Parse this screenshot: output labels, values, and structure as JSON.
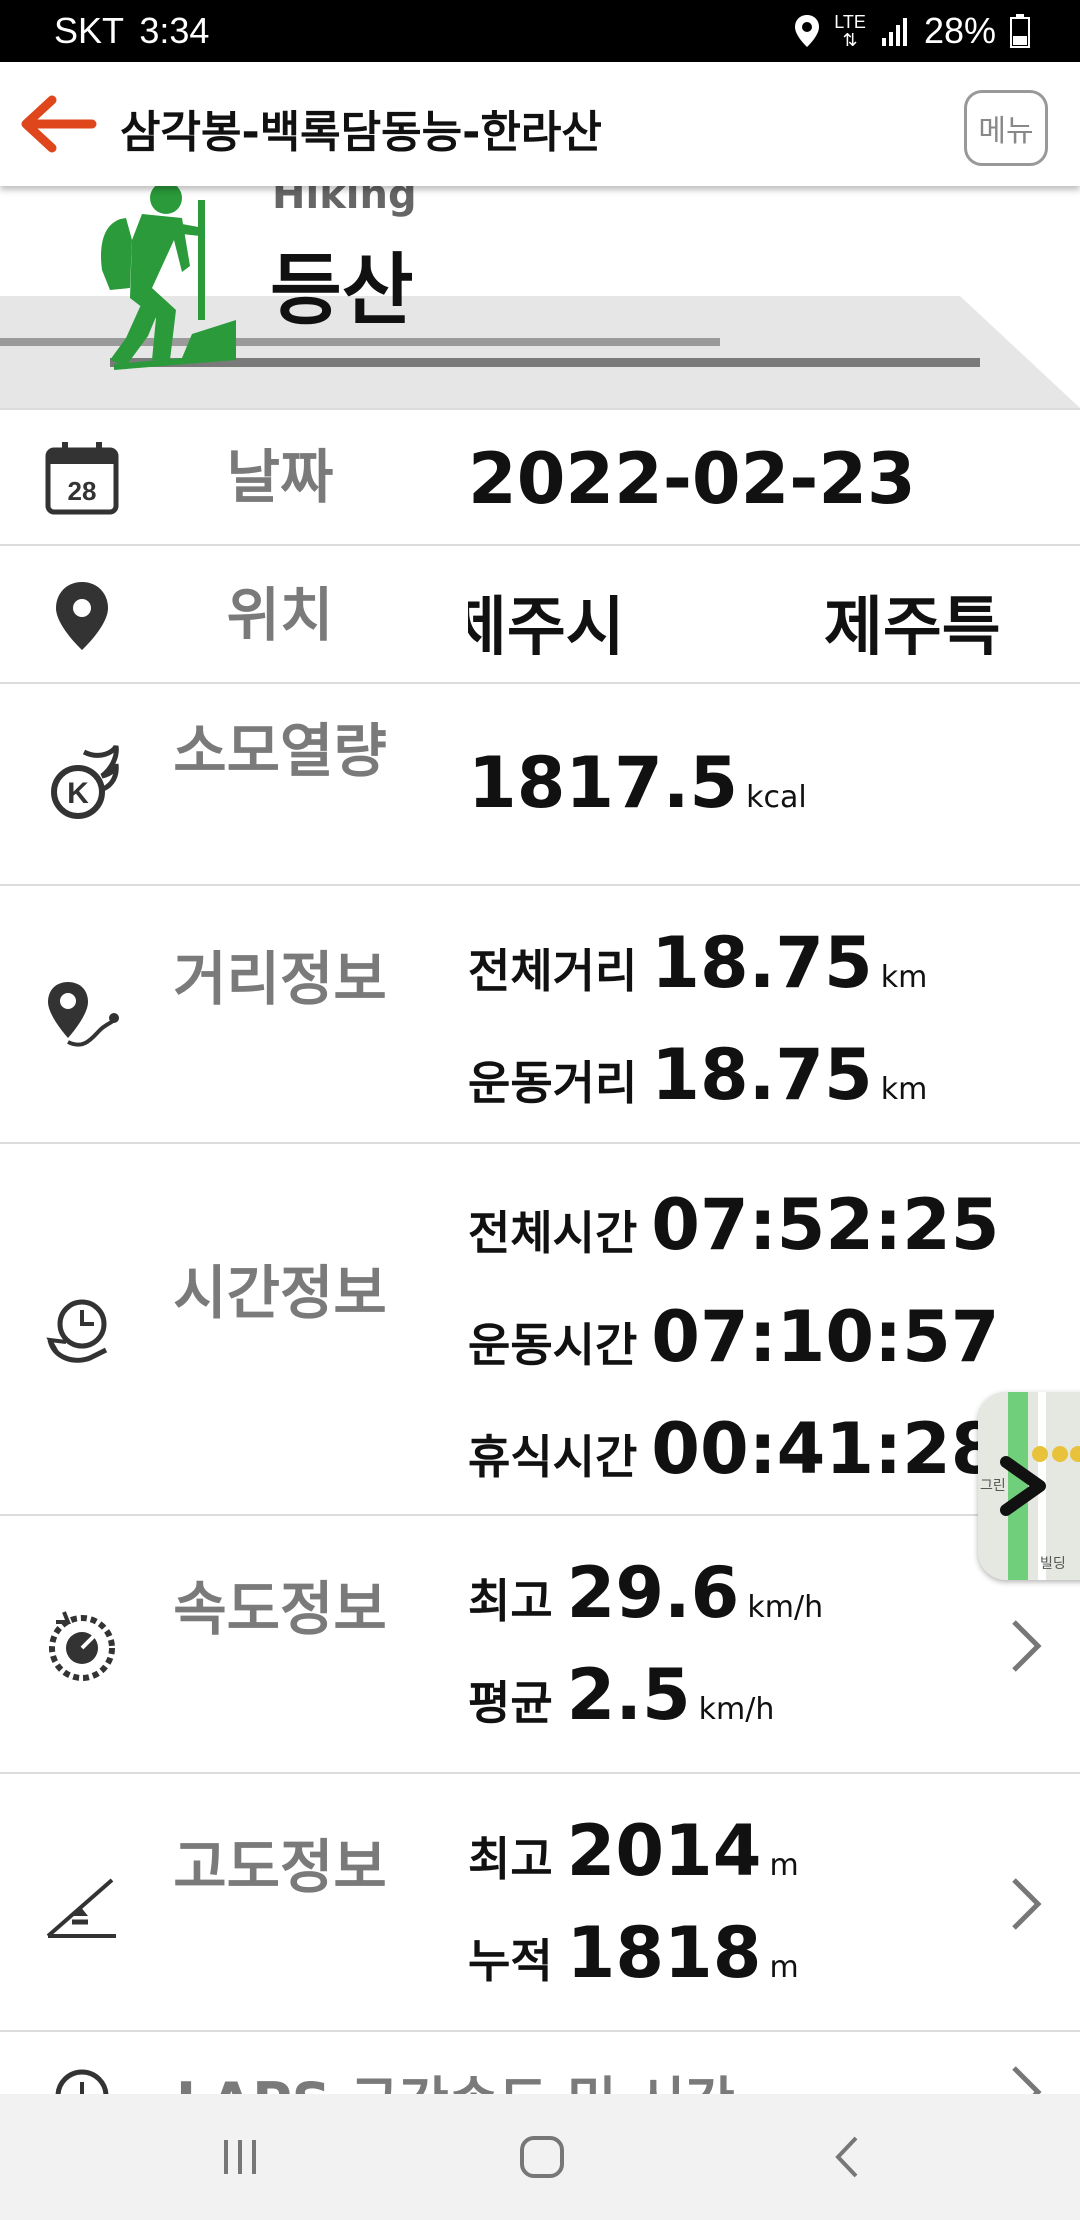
{
  "status_bar": {
    "carrier": "SKT",
    "time": "3:34",
    "network": "LTE",
    "battery": "28%"
  },
  "app_bar": {
    "title": "삼각봉-백록담동능-한라산",
    "menu_label": "메뉴"
  },
  "banner": {
    "activity_en": "Hiking",
    "activity_ko": "등산",
    "accent_color": "#2a9a3a"
  },
  "rows": {
    "date": {
      "label": "날짜",
      "value": "2022-02-23",
      "icon_text": "28"
    },
    "location": {
      "label": "위치",
      "value_part1": "제주시",
      "value_part2": "제주특별"
    },
    "calories": {
      "label": "소모열량",
      "value": "1817.5",
      "unit": "kcal",
      "icon_text": "K"
    },
    "distance": {
      "label": "거리정보",
      "total_label": "전체거리",
      "total_value": "18.75",
      "total_unit": "km",
      "moving_label": "운동거리",
      "moving_value": "18.75",
      "moving_unit": "km"
    },
    "time": {
      "label": "시간정보",
      "total_label": "전체시간",
      "total_value": "07:52:25",
      "moving_label": "운동시간",
      "moving_value": "07:10:57",
      "rest_label": "휴식시간",
      "rest_value": "00:41:28"
    },
    "speed": {
      "label": "속도정보",
      "max_label": "최고",
      "max_value": "29.6",
      "max_unit": "km/h",
      "avg_label": "평균",
      "avg_value": "2.5",
      "avg_unit": "km/h"
    },
    "altitude": {
      "label": "고도정보",
      "max_label": "최고",
      "max_value": "2014",
      "max_unit": "m",
      "cum_label": "누적",
      "cum_value": "1818",
      "cum_unit": "m"
    },
    "laps": {
      "label": "LAPS 구간속도 및 시간"
    }
  },
  "map_thumb": {
    "text_1": "그린",
    "text_2": "빌딩"
  },
  "icons": {
    "back": "arrow-left-icon",
    "chevron": "chevron-right-icon",
    "nav_recents": "recents-icon",
    "nav_home": "home-icon",
    "nav_back": "back-icon"
  }
}
